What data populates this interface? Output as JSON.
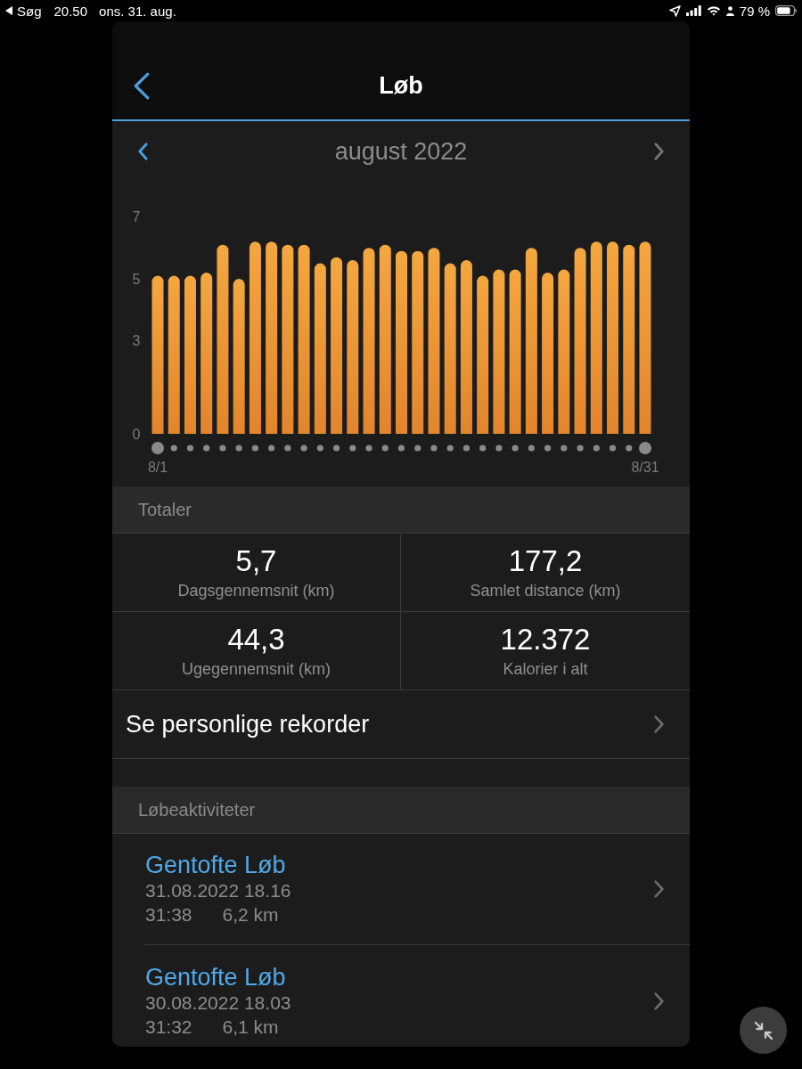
{
  "status_bar": {
    "back_label": "Søg",
    "time": "20.50",
    "date": "ons. 31. aug.",
    "battery": "79 %"
  },
  "header": {
    "title": "Løb"
  },
  "month_nav": {
    "label": "august 2022",
    "prev_disabled": false,
    "next_disabled": true
  },
  "chart": {
    "chart_data": {
      "type": "bar",
      "categories": [
        "8/1",
        null,
        null,
        null,
        null,
        null,
        null,
        null,
        null,
        null,
        null,
        null,
        null,
        null,
        null,
        null,
        null,
        null,
        null,
        null,
        null,
        null,
        null,
        null,
        null,
        null,
        null,
        null,
        null,
        null,
        "8/31"
      ],
      "values": [
        5.1,
        5.1,
        5.1,
        5.2,
        6.1,
        5.0,
        6.2,
        6.2,
        6.1,
        6.1,
        5.5,
        5.7,
        5.6,
        6.0,
        6.1,
        5.9,
        5.9,
        6.0,
        5.5,
        5.6,
        5.1,
        5.3,
        5.3,
        6.0,
        5.2,
        5.3,
        6.0,
        6.2,
        6.2,
        6.1,
        6.2
      ],
      "ylim": [
        0,
        7
      ],
      "yticks": [
        0,
        3,
        5,
        7
      ]
    }
  },
  "totals": {
    "title": "Totaler",
    "stats": [
      {
        "value": "5,7",
        "label": "Dagsgennemsnit (km)"
      },
      {
        "value": "177,2",
        "label": "Samlet distance (km)"
      },
      {
        "value": "44,3",
        "label": "Ugegennemsnit (km)"
      },
      {
        "value": "12.372",
        "label": "Kalorier i alt"
      }
    ]
  },
  "records_link": {
    "label": "Se personlige rekorder"
  },
  "activities": {
    "title": "Løbeaktiviteter",
    "items": [
      {
        "name": "Gentofte Løb",
        "datetime": "31.08.2022 18.16",
        "duration": "31:38",
        "distance": "6,2 km"
      },
      {
        "name": "Gentofte Løb",
        "datetime": "30.08.2022 18.03",
        "duration": "31:32",
        "distance": "6,1 km"
      }
    ]
  }
}
